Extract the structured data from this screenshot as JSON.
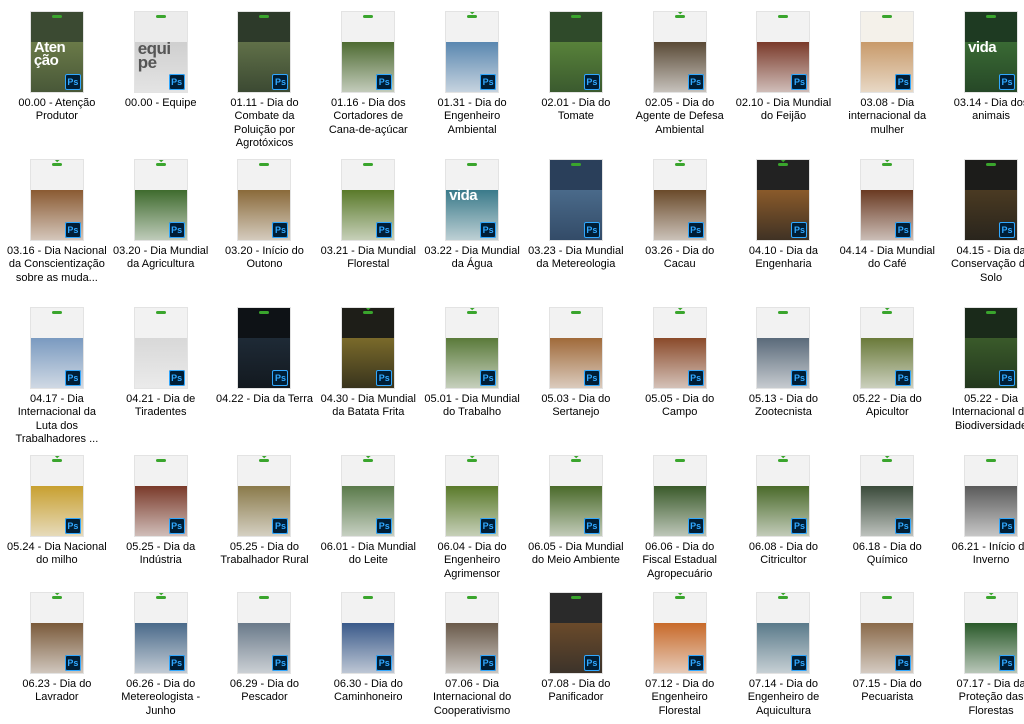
{
  "files": [
    {
      "name": "00.00 - Atenção Produtor",
      "thumb": {
        "bg": "#3b4a32",
        "photo": "#6a7a48",
        "arc": false,
        "text": "Aten ção"
      }
    },
    {
      "name": "00.00 - Equipe",
      "thumb": {
        "bg": "#ececec",
        "photo": "#cfcfcf",
        "arc": false,
        "text": "equi pe"
      }
    },
    {
      "name": "01.11 - Dia do Combate da Poluição por Agrotóxicos",
      "thumb": {
        "bg": "#2d3a2a",
        "photo": "#607048",
        "arc": false,
        "text": ""
      }
    },
    {
      "name": "01.16 - Dia dos Cortadores de Cana-de-açúcar",
      "thumb": {
        "bg": "#f2f2f2",
        "photo": "#4e6b32",
        "arc": false,
        "text": ""
      }
    },
    {
      "name": "01.31 - Dia do Engenheiro Ambiental",
      "thumb": {
        "bg": "#f2f2f2",
        "photo": "#5a87b0",
        "arc": true,
        "text": ""
      }
    },
    {
      "name": "02.01 - Dia do Tomate",
      "thumb": {
        "bg": "#2f4a2a",
        "photo": "#58823a",
        "arc": false,
        "text": ""
      }
    },
    {
      "name": "02.05 - Dia do Agente de Defesa Ambiental",
      "thumb": {
        "bg": "#f2f2f2",
        "photo": "#5a4a36",
        "arc": true,
        "text": ""
      }
    },
    {
      "name": "02.10 - Dia Mundial do Feijão",
      "thumb": {
        "bg": "#f2f2f2",
        "photo": "#7a3a2a",
        "arc": false,
        "text": ""
      }
    },
    {
      "name": "03.08 - Dia internacional da mulher",
      "thumb": {
        "bg": "#f4f1ea",
        "photo": "#c89a6a",
        "arc": false,
        "text": ""
      }
    },
    {
      "name": "03.14 - Dia dos animais",
      "thumb": {
        "bg": "#1e3a22",
        "photo": "#3a6a34",
        "arc": false,
        "text": "vida"
      }
    },
    {
      "name": "03.16 - Dia Nacional da Conscientização sobre as muda...",
      "thumb": {
        "bg": "#f2f2f2",
        "photo": "#8a5a32",
        "arc": true,
        "text": ""
      }
    },
    {
      "name": "03.20 - Dia Mundial da Agricultura",
      "thumb": {
        "bg": "#f2f2f2",
        "photo": "#3f6b2e",
        "arc": true,
        "text": ""
      }
    },
    {
      "name": "03.20 - Início do Outono",
      "thumb": {
        "bg": "#f2f2f2",
        "photo": "#8a6a3a",
        "arc": false,
        "text": ""
      }
    },
    {
      "name": "03.21 - Dia Mundial Florestal",
      "thumb": {
        "bg": "#f2f2f2",
        "photo": "#5a7a2a",
        "arc": false,
        "text": ""
      }
    },
    {
      "name": "03.22 - Dia Mundial da Água",
      "thumb": {
        "bg": "#f2f2f2",
        "photo": "#3a7a8a",
        "arc": false,
        "text": "vida"
      }
    },
    {
      "name": "03.23 - Dia Mundial da Metereologia",
      "thumb": {
        "bg": "#2a3f5a",
        "photo": "#4a6a8a",
        "arc": false,
        "text": ""
      }
    },
    {
      "name": "03.26 - Dia do Cacau",
      "thumb": {
        "bg": "#f2f2f2",
        "photo": "#6a4a2a",
        "arc": true,
        "text": ""
      }
    },
    {
      "name": "04.10 - Dia da Engenharia",
      "thumb": {
        "bg": "#222222",
        "photo": "#8a5a2a",
        "arc": true,
        "text": ""
      }
    },
    {
      "name": "04.14 - Dia Mundial do Café",
      "thumb": {
        "bg": "#f2f2f2",
        "photo": "#6a3a22",
        "arc": true,
        "text": ""
      }
    },
    {
      "name": "04.15 - Dia da Conservação do Solo",
      "thumb": {
        "bg": "#1c1c1a",
        "photo": "#4a3a22",
        "arc": false,
        "text": ""
      }
    },
    {
      "name": "04.17 - Dia Internacional da Luta dos Trabalhadores ...",
      "thumb": {
        "bg": "#f2f2f2",
        "photo": "#7a9ac0",
        "arc": false,
        "text": ""
      }
    },
    {
      "name": "04.21 - Dia de Tiradentes",
      "thumb": {
        "bg": "#f2f2f2",
        "photo": "#d8d8d8",
        "arc": false,
        "text": ""
      }
    },
    {
      "name": "04.22 - Dia da Terra",
      "thumb": {
        "bg": "#0e1216",
        "photo": "#1e2a36",
        "arc": false,
        "text": ""
      }
    },
    {
      "name": "04.30 - Dia Mundial da Batata Frita",
      "thumb": {
        "bg": "#1e1e18",
        "photo": "#7a6a2a",
        "arc": true,
        "text": ""
      }
    },
    {
      "name": "05.01 - Dia Mundial do Trabalho",
      "thumb": {
        "bg": "#f2f2f2",
        "photo": "#5a7a3a",
        "arc": true,
        "text": ""
      }
    },
    {
      "name": "05.03 - Dia do Sertanejo",
      "thumb": {
        "bg": "#f2f2f2",
        "photo": "#a06a3a",
        "arc": false,
        "text": ""
      }
    },
    {
      "name": "05.05 - Dia do Campo",
      "thumb": {
        "bg": "#f2f2f2",
        "photo": "#8a4a2a",
        "arc": true,
        "text": ""
      }
    },
    {
      "name": "05.13 - Dia do Zootecnista",
      "thumb": {
        "bg": "#f2f2f2",
        "photo": "#5a6a7a",
        "arc": false,
        "text": ""
      }
    },
    {
      "name": "05.22 - Dia do Apicultor",
      "thumb": {
        "bg": "#f2f2f2",
        "photo": "#6a7a3a",
        "arc": true,
        "text": ""
      }
    },
    {
      "name": "05.22 - Dia Internacional da Biodiversidade",
      "thumb": {
        "bg": "#1a2a1a",
        "photo": "#3a5a2a",
        "arc": false,
        "text": ""
      }
    },
    {
      "name": "05.24 - Dia Nacional do milho",
      "thumb": {
        "bg": "#f2f2f2",
        "photo": "#c8a030",
        "arc": true,
        "text": ""
      }
    },
    {
      "name": "05.25 - Dia da Indústria",
      "thumb": {
        "bg": "#f2f2f2",
        "photo": "#7a3a2a",
        "arc": false,
        "text": ""
      }
    },
    {
      "name": "05.25 - Dia do Trabalhador Rural",
      "thumb": {
        "bg": "#f2f2f2",
        "photo": "#8a7a4a",
        "arc": true,
        "text": ""
      }
    },
    {
      "name": "06.01 - Dia Mundial do Leite",
      "thumb": {
        "bg": "#f2f2f2",
        "photo": "#5a7a4a",
        "arc": true,
        "text": ""
      }
    },
    {
      "name": "06.04 - Dia do Engenheiro Agrimensor",
      "thumb": {
        "bg": "#f2f2f2",
        "photo": "#5a7a2a",
        "arc": true,
        "text": ""
      }
    },
    {
      "name": "06.05 - Dia Mundial do Meio Ambiente",
      "thumb": {
        "bg": "#f2f2f2",
        "photo": "#4a6a2a",
        "arc": true,
        "text": ""
      }
    },
    {
      "name": "06.06 - Dia do Fiscal Estadual Agropecuário",
      "thumb": {
        "bg": "#f2f2f2",
        "photo": "#3a5a2a",
        "arc": false,
        "text": ""
      }
    },
    {
      "name": "06.08 - Dia do Citricultor",
      "thumb": {
        "bg": "#f2f2f2",
        "photo": "#4a6a2a",
        "arc": true,
        "text": ""
      }
    },
    {
      "name": "06.18 - Dia do Químico",
      "thumb": {
        "bg": "#f2f2f2",
        "photo": "#3a4a3a",
        "arc": true,
        "text": ""
      }
    },
    {
      "name": "06.21 - Início do Inverno",
      "thumb": {
        "bg": "#f2f2f2",
        "photo": "#5a5a5a",
        "arc": false,
        "text": ""
      }
    },
    {
      "name": "06.23 - Dia do Lavrador",
      "thumb": {
        "bg": "#f2f2f2",
        "photo": "#7a5a3a",
        "arc": true,
        "text": ""
      }
    },
    {
      "name": "06.26 - Dia do Metereologista - Junho",
      "thumb": {
        "bg": "#f2f2f2",
        "photo": "#4a6a8a",
        "arc": true,
        "text": ""
      }
    },
    {
      "name": "06.29 - Dia do Pescador",
      "thumb": {
        "bg": "#f2f2f2",
        "photo": "#6a7a8a",
        "arc": false,
        "text": ""
      }
    },
    {
      "name": "06.30 - Dia do Caminhoneiro",
      "thumb": {
        "bg": "#f2f2f2",
        "photo": "#3a5a8a",
        "arc": false,
        "text": ""
      }
    },
    {
      "name": "07.06 - Dia Internacional do Cooperativismo",
      "thumb": {
        "bg": "#f2f2f2",
        "photo": "#6a5a4a",
        "arc": false,
        "text": ""
      }
    },
    {
      "name": "07.08 - Dia do Panificador",
      "thumb": {
        "bg": "#2a2a2a",
        "photo": "#6a4a2a",
        "arc": false,
        "text": ""
      }
    },
    {
      "name": "07.12 - Dia do Engenheiro Florestal",
      "thumb": {
        "bg": "#f2f2f2",
        "photo": "#c86a2a",
        "arc": true,
        "text": ""
      }
    },
    {
      "name": "07.14 - Dia do Engenheiro de Aquicultura",
      "thumb": {
        "bg": "#f2f2f2",
        "photo": "#5a7a8a",
        "arc": true,
        "text": ""
      }
    },
    {
      "name": "07.15 - Dia do Pecuarista",
      "thumb": {
        "bg": "#f2f2f2",
        "photo": "#8a6a4a",
        "arc": false,
        "text": ""
      }
    },
    {
      "name": "07.17 - Dia da Proteção das Florestas",
      "thumb": {
        "bg": "#f2f2f2",
        "photo": "#2a5a2a",
        "arc": true,
        "text": ""
      }
    }
  ],
  "icon": {
    "name": "photoshop-icon",
    "label": "Ps"
  },
  "colors": {
    "accent": "#3aa52d",
    "ps_bg": "#001e36",
    "ps_fg": "#31a8ff"
  }
}
